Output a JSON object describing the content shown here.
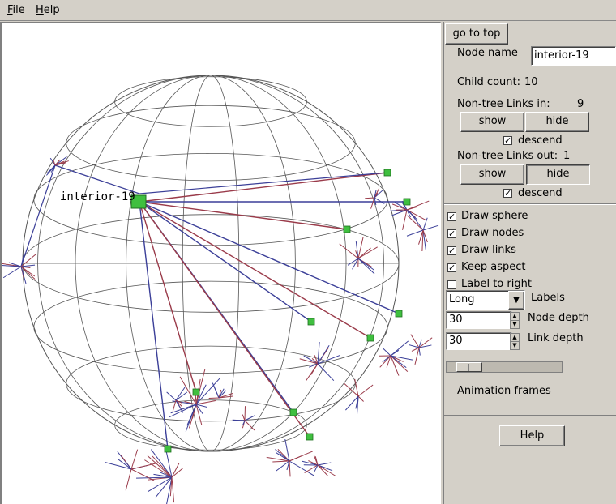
{
  "menu": {
    "file": "File",
    "file_mnemonic": "F",
    "file_rest": "ile",
    "help": "Help",
    "help_mnemonic": "H",
    "help_rest": "elp"
  },
  "viewer": {
    "focus_label": "interior-19"
  },
  "panel": {
    "go_to_top": "go to top",
    "node_name_label": "Node name",
    "node_name_value": "interior-19",
    "child_count_label": "Child count:",
    "child_count_value": "10",
    "links_in_label": "Non-tree Links in:",
    "links_in_value": "9",
    "show": "show",
    "hide": "hide",
    "descend": "descend",
    "links_out_label": "Non-tree Links out:",
    "links_out_value": "1",
    "options": [
      {
        "label": "Draw sphere",
        "checked": true
      },
      {
        "label": "Draw nodes",
        "checked": true
      },
      {
        "label": "Draw links",
        "checked": true
      },
      {
        "label": "Keep aspect",
        "checked": true
      },
      {
        "label": "Label to right",
        "checked": false
      }
    ],
    "labels_select_value": "Long",
    "labels_label": "Labels",
    "node_depth_value": "30",
    "node_depth_label": "Node depth",
    "link_depth_value": "30",
    "link_depth_label": "Link depth",
    "animation_frames_label": "Animation frames",
    "help_button": "Help"
  },
  "colors": {
    "link_red": "#9a3b4a",
    "link_blue": "#3b3f98",
    "node_green": "#3fbf3f",
    "grid": "#555555"
  }
}
